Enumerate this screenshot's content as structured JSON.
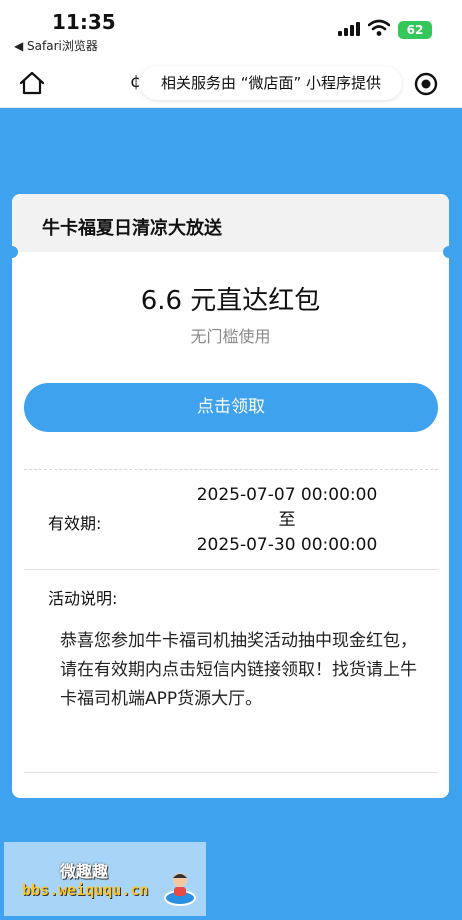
{
  "status_bar": {
    "time": "11:35",
    "back_app": "◀ Safari浏览器",
    "battery": "62"
  },
  "nav": {
    "title_stub": "¢",
    "service_notice": "相关服务由 “微店面” 小程序提供"
  },
  "card": {
    "title": "牛卡福夏日清凉大放送",
    "amount_line": "6.6 元直达红包",
    "condition": "无门槛使用",
    "claim_label": "点击领取",
    "validity": {
      "label": "有效期:",
      "start": "2025-07-07 00:00:00",
      "separator": "至",
      "end": "2025-07-30 00:00:00"
    },
    "description": {
      "label": "活动说明:",
      "text": "恭喜您参加牛卡福司机抽奖活动抽中现金红包，请在有效期内点击短信内链接领取！找货请上牛卡福司机端APP货源大厅。"
    }
  },
  "watermark": {
    "title": "微趣趣",
    "url": "bbs.weiququ.cn"
  },
  "colors": {
    "accent": "#3ea2ee",
    "battery": "#34c759"
  }
}
